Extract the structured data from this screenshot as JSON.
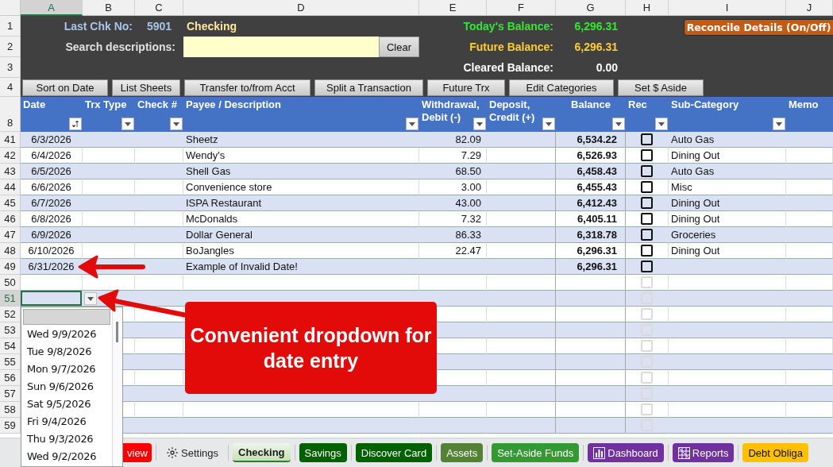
{
  "column_headers": [
    {
      "letter": "A",
      "selected": true
    },
    {
      "letter": "B",
      "selected": false
    },
    {
      "letter": "C",
      "selected": false
    },
    {
      "letter": "D",
      "selected": false
    },
    {
      "letter": "E",
      "selected": false
    },
    {
      "letter": "F",
      "selected": false
    },
    {
      "letter": "G",
      "selected": false
    },
    {
      "letter": "H",
      "selected": false
    },
    {
      "letter": "I",
      "selected": false
    },
    {
      "letter": "J",
      "selected": false
    }
  ],
  "top_row_numbers": [
    "1",
    "2",
    "3",
    "4"
  ],
  "summary": {
    "last_check_label": "Last Chk No:",
    "last_check_number": "5901",
    "account_name": "Checking",
    "search_label": "Search descriptions:",
    "clear_button": "Clear",
    "reconcile_button": "Reconcile Details (On/Off)",
    "balances": [
      {
        "label": "Today's Balance:",
        "value": "6,296.31",
        "color": "#33e633"
      },
      {
        "label": "Future Balance:",
        "value": "6,296.31",
        "color": "#ffcc33"
      },
      {
        "label": "Cleared Balance:",
        "value": "0.00",
        "color": "#ffffff"
      }
    ]
  },
  "toolbar": [
    "Sort on Date",
    "List Sheets",
    "Transfer to/from Acct",
    "Split a Transaction",
    "Future Trx",
    "Edit Categories",
    "Set $ Aside"
  ],
  "table": {
    "header_row_number": "8",
    "columns": [
      {
        "label": "Date",
        "kind": "sort"
      },
      {
        "label": "Trx Type",
        "kind": "filter"
      },
      {
        "label": "Check #",
        "kind": "filter"
      },
      {
        "label": "Payee / Description",
        "kind": "filter"
      },
      {
        "label": "Withdrawal, Debit (-)",
        "kind": "filter"
      },
      {
        "label": "Deposit, Credit (+)",
        "kind": "filter"
      },
      {
        "label": "Balance",
        "kind": "filter"
      },
      {
        "label": "Rec",
        "kind": "filter"
      },
      {
        "label": "Sub-Category",
        "kind": "filter"
      },
      {
        "label": "Memo",
        "kind": "plain"
      }
    ],
    "rows": [
      {
        "row_number": "41",
        "date": "6/3/2026",
        "payee": "Sheetz",
        "withdrawal": "82.09",
        "balance": "6,534.22",
        "reconciled": false,
        "category": "Auto Gas"
      },
      {
        "row_number": "42",
        "date": "6/4/2026",
        "payee": "Wendy's",
        "withdrawal": "7.29",
        "balance": "6,526.93",
        "reconciled": false,
        "category": "Dining Out"
      },
      {
        "row_number": "43",
        "date": "6/5/2026",
        "payee": "Shell Gas",
        "withdrawal": "68.50",
        "balance": "6,458.43",
        "reconciled": false,
        "category": "Auto Gas"
      },
      {
        "row_number": "44",
        "date": "6/6/2026",
        "payee": "Convenience store",
        "withdrawal": "3.00",
        "balance": "6,455.43",
        "reconciled": false,
        "category": "Misc"
      },
      {
        "row_number": "45",
        "date": "6/7/2026",
        "payee": "ISPA Restaurant",
        "withdrawal": "43.00",
        "balance": "6,412.43",
        "reconciled": false,
        "category": "Dining Out"
      },
      {
        "row_number": "46",
        "date": "6/8/2026",
        "payee": "McDonalds",
        "withdrawal": "7.32",
        "balance": "6,405.11",
        "reconciled": false,
        "category": "Dining Out"
      },
      {
        "row_number": "47",
        "date": "6/9/2026",
        "payee": "Dollar General",
        "withdrawal": "86.33",
        "balance": "6,318.78",
        "reconciled": false,
        "category": "Groceries"
      },
      {
        "row_number": "48",
        "date": "6/10/2026",
        "payee": "BoJangles",
        "withdrawal": "22.47",
        "balance": "6,296.31",
        "reconciled": false,
        "category": "Dining Out"
      },
      {
        "row_number": "49",
        "date": "6/31/2026",
        "payee": "Example of Invalid Date!",
        "balance": "6,296.31",
        "reconciled": false
      }
    ],
    "empty_rows": [
      {
        "row_number": "50",
        "selected": false,
        "reconciled": false
      },
      {
        "row_number": "51",
        "selected": true,
        "reconciled": false
      },
      {
        "row_number": "52",
        "selected": false,
        "reconciled": false
      },
      {
        "row_number": "53",
        "selected": false,
        "reconciled": false
      },
      {
        "row_number": "54",
        "selected": false,
        "reconciled": false
      },
      {
        "row_number": "55",
        "selected": false,
        "reconciled": false
      },
      {
        "row_number": "56",
        "selected": false,
        "reconciled": false
      },
      {
        "row_number": "57",
        "selected": false,
        "reconciled": false
      },
      {
        "row_number": "58",
        "selected": false,
        "reconciled": false
      },
      {
        "row_number": "59",
        "selected": false,
        "reconciled": false
      }
    ]
  },
  "date_dropdown": {
    "blank_item_highlighted": true,
    "items": [
      "Wed 9/9/2026",
      "Tue 9/8/2026",
      "Mon 9/7/2026",
      "Sun 9/6/2026",
      "Sat 9/5/2026",
      "Fri 9/4/2026",
      "Thu 9/3/2026",
      "Wed 9/2/2026"
    ]
  },
  "callout": "Convenient dropdown for date entry",
  "sheet_tabs": [
    {
      "label": "view",
      "color": "#ff0000",
      "selected": false
    },
    {
      "label": "Settings",
      "selected": false
    },
    {
      "label": "Checking",
      "color": "#c6e0b4",
      "selected": true
    },
    {
      "label": "Savings",
      "color": "#006100",
      "selected": false
    },
    {
      "label": "Discover Card",
      "color": "#006100",
      "selected": false
    },
    {
      "label": "Assets",
      "color": "#548235",
      "selected": false
    },
    {
      "label": "Set-Aside Funds",
      "color": "#339933",
      "selected": false
    },
    {
      "label": "Dashboard",
      "color": "#7030a0",
      "selected": false
    },
    {
      "label": "Reports",
      "color": "#7030a0",
      "selected": false
    },
    {
      "label": "Debt Obliga",
      "color": "#ffc000",
      "selected": false
    }
  ]
}
